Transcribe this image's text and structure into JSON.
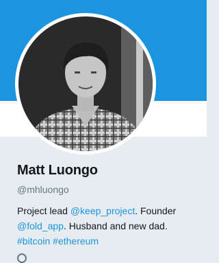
{
  "profile": {
    "name": "Matt Luongo",
    "screen_name": "@mhluongo",
    "avatar": "avatar-photo"
  },
  "bio": {
    "text_1": "Project lead ",
    "mention_1": "@keep_project",
    "text_2": ". Founder",
    "mention_2": "@fold_app",
    "text_3": ". Husband and new dad.",
    "hashtag_1": "#bitcoin",
    "hashtag_2": "#ethereum"
  },
  "icons": {
    "location": "location-icon"
  },
  "colors": {
    "banner": "#1b95e0",
    "link": "#1b95e0",
    "background": "#e6ecf0",
    "name": "#14171a",
    "muted": "#657786"
  }
}
